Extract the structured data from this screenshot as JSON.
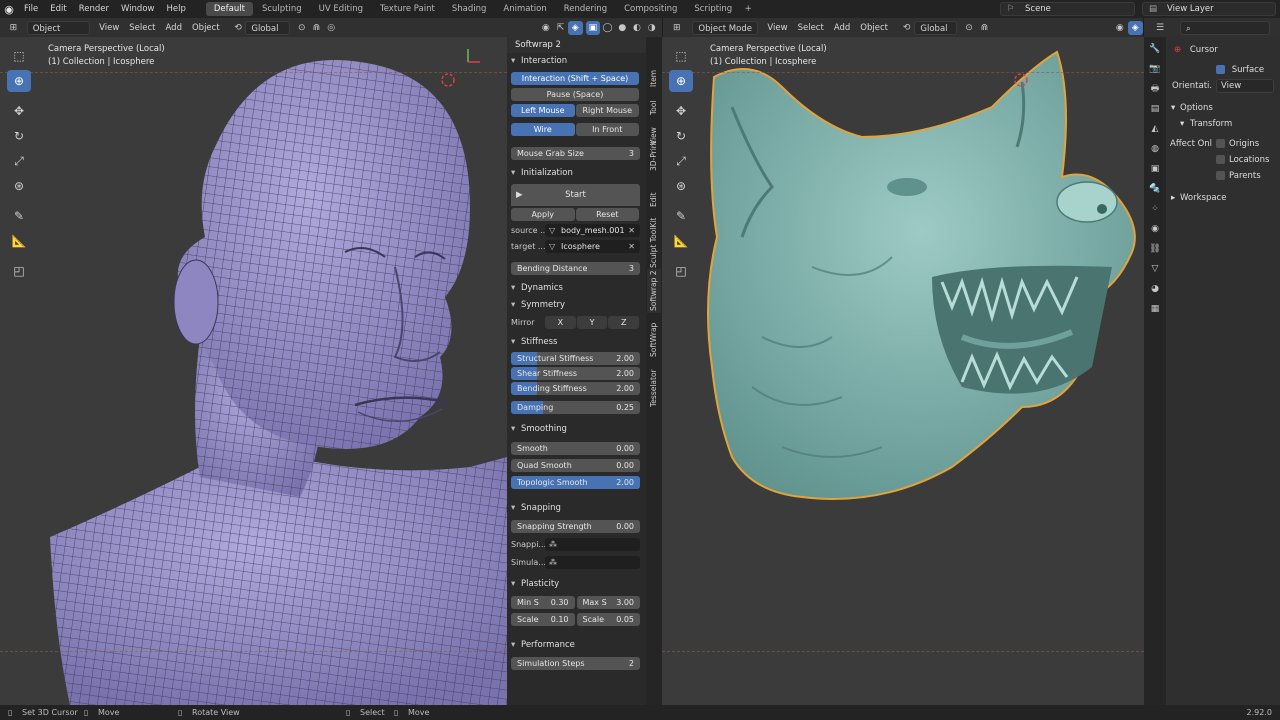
{
  "menu": [
    "File",
    "Edit",
    "Render",
    "Window",
    "Help"
  ],
  "workspaces": [
    "Default",
    "Sculpting",
    "UV Editing",
    "Texture Paint",
    "Shading",
    "Animation",
    "Rendering",
    "Compositing",
    "Scripting"
  ],
  "active_workspace": "Default",
  "scene": "Scene",
  "view_layer": "View Layer",
  "left_header": {
    "mode": "Object Mode",
    "view": "View",
    "select": "Select",
    "add": "Add",
    "object": "Object",
    "orientation": "Global"
  },
  "right_header": {
    "mode": "Object Mode",
    "view": "View",
    "select": "Select",
    "add": "Add",
    "object": "Object",
    "orientation": "Global"
  },
  "left_viewport": {
    "line1": "Camera Perspective (Local)",
    "line2": "(1) Collection | Icosphere"
  },
  "right_viewport": {
    "line1": "Camera Perspective (Local)",
    "line2": "(1) Collection | Icosphere"
  },
  "panel": {
    "title": "Softwrap 2",
    "interaction": {
      "header": "Interaction",
      "interaction_btn": "Interaction (Shift + Space)",
      "pause_btn": "Pause (Space)",
      "left_mouse": "Left Mouse",
      "right_mouse": "Right Mouse",
      "wire": "Wire",
      "in_front": "In Front",
      "grab_label": "Mouse Grab Size",
      "grab_value": "3"
    },
    "initialization": {
      "header": "Initialization",
      "start": "Start",
      "apply": "Apply",
      "reset": "Reset",
      "source_label": "source ...",
      "source_value": "body_mesh.001",
      "target_label": "target ...",
      "target_value": "Icosphere",
      "bending_label": "Bending Distance",
      "bending_value": "3"
    },
    "dynamics": {
      "header": "Dynamics"
    },
    "symmetry": {
      "header": "Symmetry",
      "mirror": "Mirror",
      "x": "X",
      "y": "Y",
      "z": "Z"
    },
    "stiffness": {
      "header": "Stiffness",
      "structural_label": "Structural Stiffness",
      "structural_value": "2.00",
      "shear_label": "Shear Stiffness",
      "shear_value": "2.00",
      "bending_label": "Bending Stiffness",
      "bending_value": "2.00",
      "damping_label": "Damping",
      "damping_value": "0.25"
    },
    "smoothing": {
      "header": "Smoothing",
      "smooth_label": "Smooth",
      "smooth_value": "0.00",
      "quad_label": "Quad Smooth",
      "quad_value": "0.00",
      "topo_label": "Topologic Smooth",
      "topo_value": "2.00"
    },
    "snapping": {
      "header": "Snapping",
      "strength_label": "Snapping Strength",
      "strength_value": "0.00",
      "snap_label": "Snappi...",
      "sim_label": "Simula..."
    },
    "plasticity": {
      "header": "Plasticity",
      "min_label": "Min S",
      "min_value": "0.30",
      "max_label": "Max S",
      "max_value": "3.00",
      "scale1_label": "Scale",
      "scale1_value": "0.10",
      "scale2_label": "Scale",
      "scale2_value": "0.05"
    },
    "performance": {
      "header": "Performance",
      "sim_steps_label": "Simulation Steps",
      "sim_steps_value": "2"
    }
  },
  "vtabs": [
    "Item",
    "Tool",
    "View",
    "3D-Print",
    "Edit",
    "Sculpt ToolKit",
    "Softwrap 2",
    "SoftWrap",
    "Tesselator"
  ],
  "props": {
    "cursor": "Cursor",
    "surface_project": "Surface Pr...",
    "orientation_label": "Orientati...",
    "orientation_value": "View",
    "options": "Options",
    "transform": "Transform",
    "affect_only": "Affect Onl",
    "origins": "Origins",
    "locations": "Locations",
    "parents": "Parents",
    "workspace": "Workspace"
  },
  "status": {
    "set_cursor": "Set 3D Cursor",
    "move1": "Move",
    "rotate": "Rotate View",
    "select": "Select",
    "move2": "Move",
    "version": "2.92.0"
  },
  "colors": {
    "accent": "#4772b3",
    "viewport_bg": "#3b3b3b",
    "mesh_purple": "#9b93cc",
    "wolf_teal": "#7db2ad",
    "selection_outline": "#e3a33a"
  }
}
